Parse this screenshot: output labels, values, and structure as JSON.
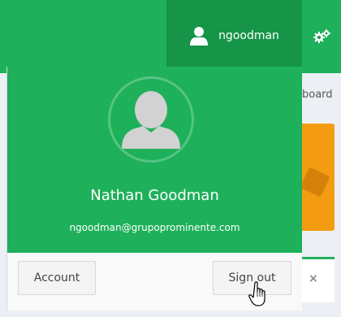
{
  "topbar": {
    "username": "ngoodman",
    "user_icon": "user-icon",
    "settings_icon": "gears-icon",
    "accent": "#1eb05a",
    "accent_dark": "#169448"
  },
  "background": {
    "board_text": "board",
    "close_symbol": "×",
    "orange": "#f39c12"
  },
  "dropdown": {
    "avatar_icon": "user-avatar-icon",
    "full_name": "Nathan Goodman",
    "email": "ngoodman@grupoprominente.com",
    "account_label": "Account",
    "signout_label": "Sign out"
  },
  "cursor_icon": "hand-pointer-icon"
}
